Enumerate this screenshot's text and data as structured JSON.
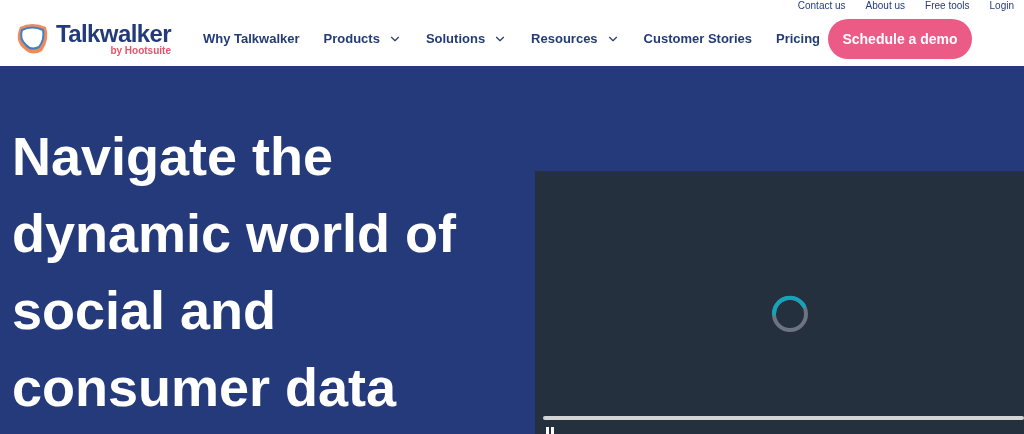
{
  "utility_links": [
    "Contact us",
    "About us",
    "Free tools",
    "Login"
  ],
  "logo": {
    "name": "Talkwalker",
    "tagline": "by Hootsuite"
  },
  "nav": [
    {
      "label": "Why Talkwalker",
      "dropdown": false
    },
    {
      "label": "Products",
      "dropdown": true
    },
    {
      "label": "Solutions",
      "dropdown": true
    },
    {
      "label": "Resources",
      "dropdown": true
    },
    {
      "label": "Customer Stories",
      "dropdown": false
    },
    {
      "label": "Pricing",
      "dropdown": false
    }
  ],
  "cta": "Schedule a demo",
  "hero": {
    "headline": "Navigate the dynamic world of social and consumer data"
  },
  "video": {
    "loading": true,
    "playing": true
  }
}
